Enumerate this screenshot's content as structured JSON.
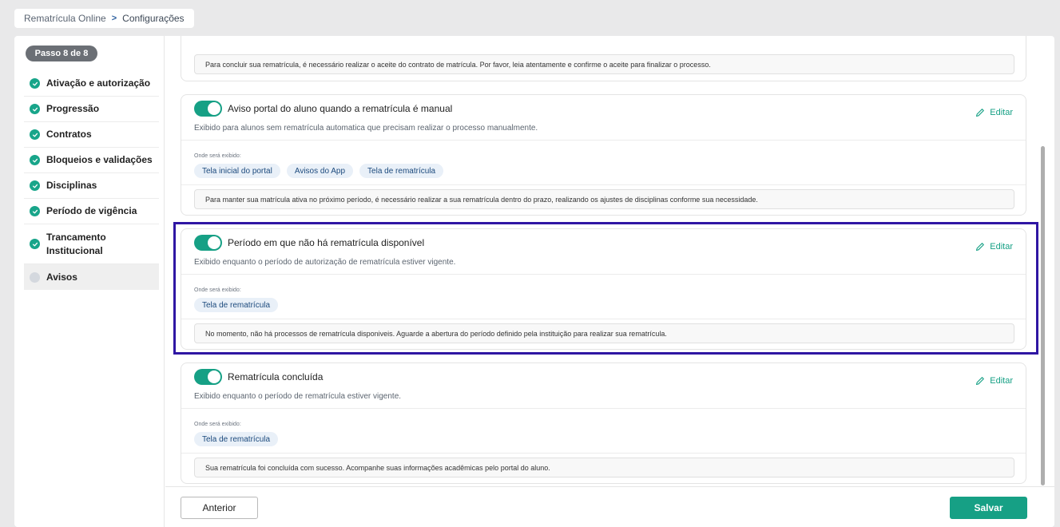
{
  "breadcrumb": {
    "root": "Rematrícula Online",
    "current": "Configurações"
  },
  "sidebar": {
    "step_label": "Passo 8 de 8",
    "items": [
      {
        "label": "Ativação e autorização",
        "status": "done"
      },
      {
        "label": "Progressão",
        "status": "done"
      },
      {
        "label": "Contratos",
        "status": "done"
      },
      {
        "label": "Bloqueios e validações",
        "status": "done"
      },
      {
        "label": "Disciplinas",
        "status": "done"
      },
      {
        "label": "Período de vigência",
        "status": "done"
      },
      {
        "label": "Trancamento Institucional",
        "status": "done"
      },
      {
        "label": "Avisos",
        "status": "current"
      }
    ]
  },
  "cards": [
    {
      "message": "Para concluir sua rematrícula, é necessário realizar o aceite do contrato de matrícula. Por favor, leia atentamente e confirme o aceite para finalizar o processo."
    },
    {
      "title": "Aviso portal do aluno quando a rematrícula é manual",
      "description": "Exibido para alunos sem rematrícula automatica que precisam realizar o processo manualmente.",
      "enabled": true,
      "edit_label": "Editar",
      "where_label": "Onde será exibido:",
      "chips": [
        "Tela inicial do portal",
        "Avisos do App",
        "Tela de rematrícula"
      ],
      "message": "Para manter sua matrícula ativa no próximo período, é necessário realizar a sua rematrícula dentro do prazo, realizando os ajustes de disciplinas conforme sua necessidade."
    },
    {
      "title": "Período em que não há rematrícula disponível",
      "description": "Exibido enquanto o período de autorização de rematrícula estiver vigente.",
      "enabled": true,
      "edit_label": "Editar",
      "where_label": "Onde será exibido:",
      "chips": [
        "Tela de rematrícula"
      ],
      "message": "No momento, não há processos de rematrícula disponiveis. Aguarde a abertura do período definido pela instituição para realizar sua rematrícula."
    },
    {
      "title": "Rematrícula concluída",
      "description": "Exibido enquanto o período de rematrícula estiver vigente.",
      "enabled": true,
      "edit_label": "Editar",
      "where_label": "Onde será exibido:",
      "chips": [
        "Tela de rematrícula"
      ],
      "message": "Sua rematrícula foi concluída com sucesso. Acompanhe suas informações acadêmicas pelo portal do aluno."
    }
  ],
  "footer": {
    "prev_label": "Anterior",
    "save_label": "Salvar"
  },
  "colors": {
    "accent": "#16a085",
    "highlight": "#2f16a3",
    "chip_bg": "#e9f0f8"
  }
}
